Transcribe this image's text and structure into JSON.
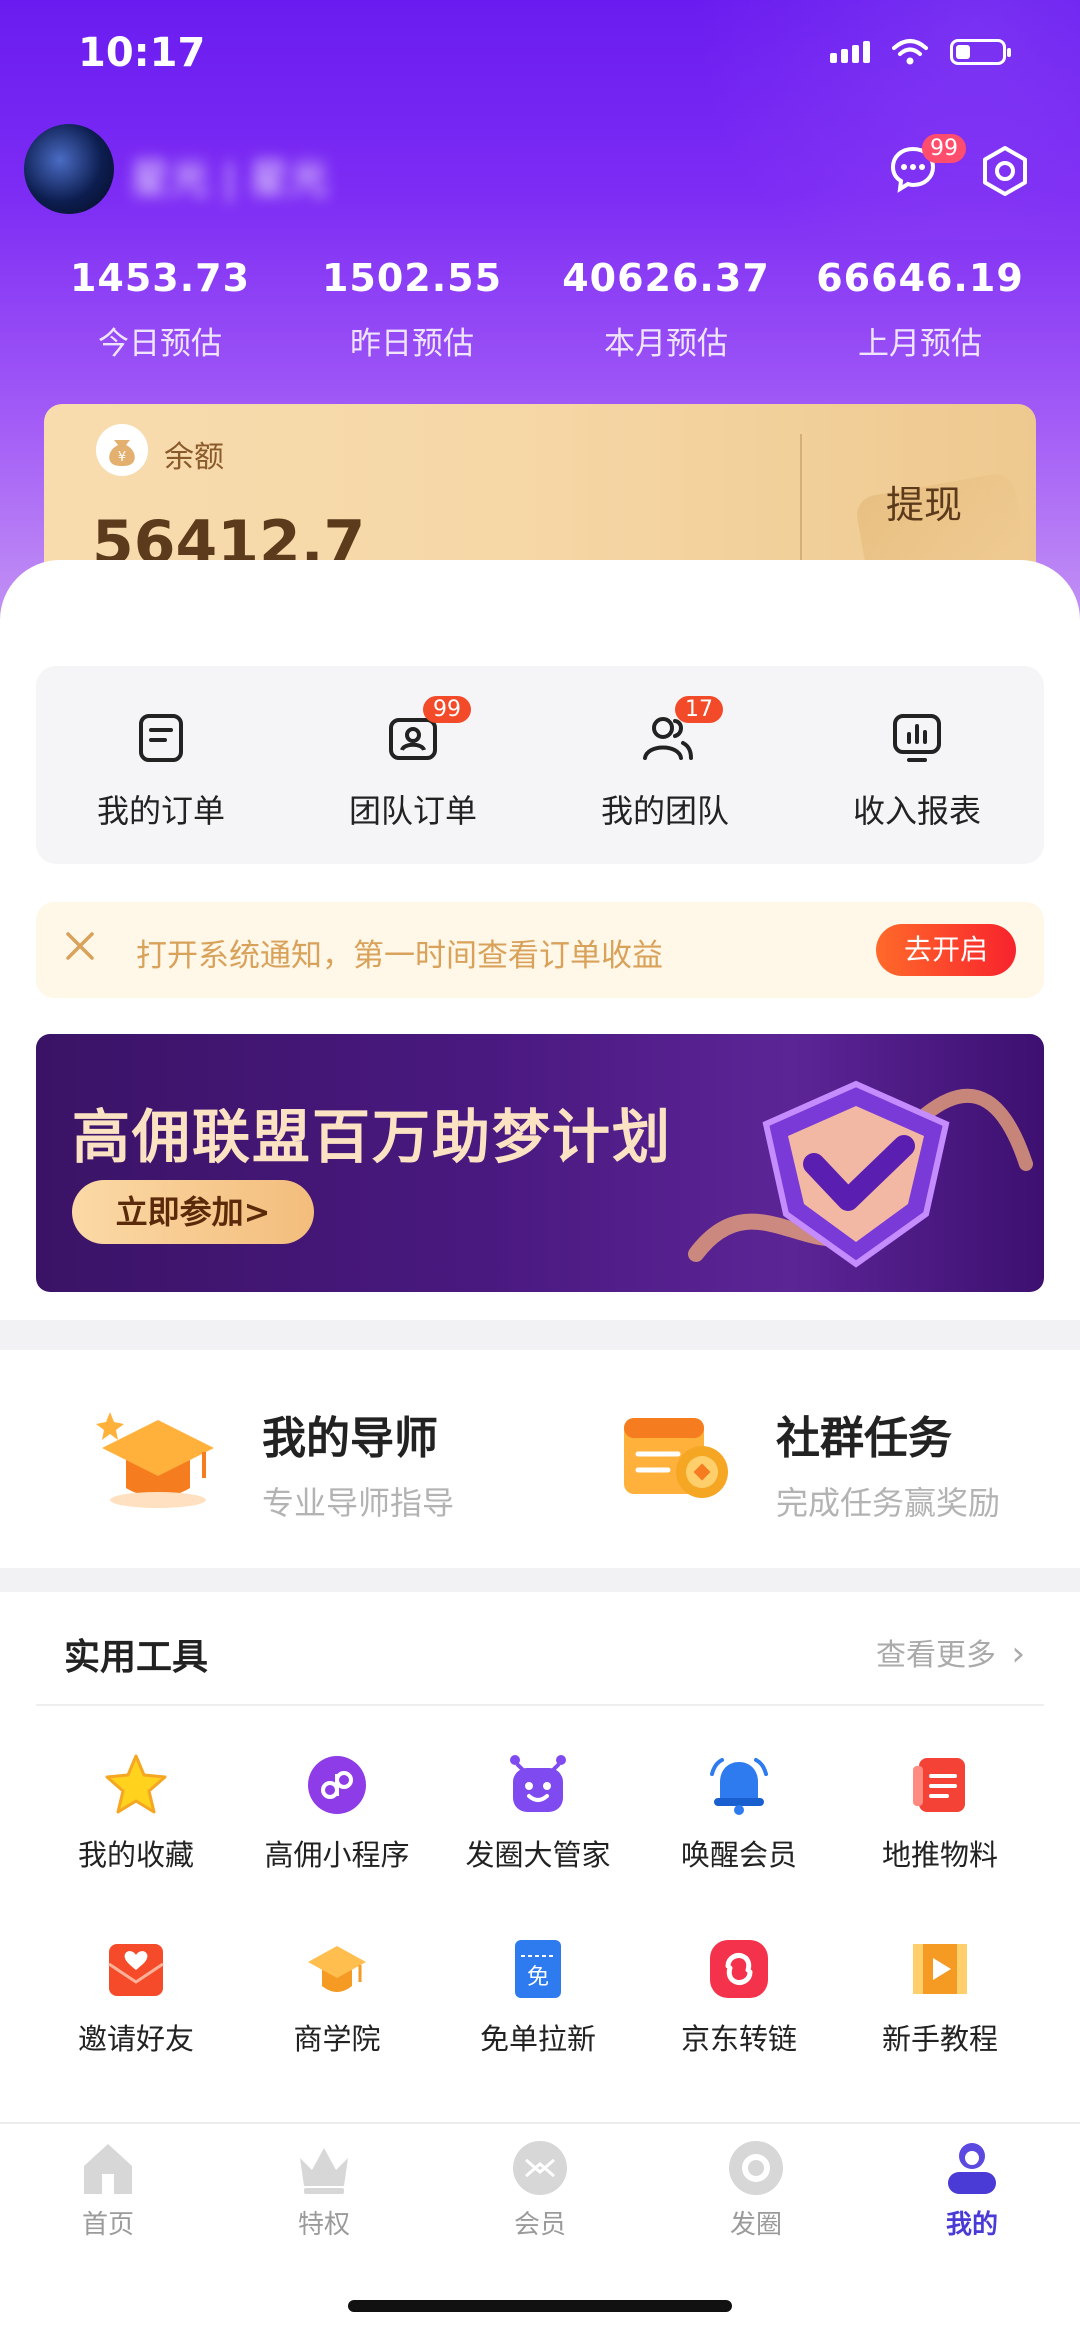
{
  "status_bar": {
    "time": "10:17"
  },
  "header": {
    "user_name": "星光 | 星光",
    "message_badge": "99"
  },
  "stats": [
    {
      "value": "1453.73",
      "label": "今日预估"
    },
    {
      "value": "1502.55",
      "label": "昨日预估"
    },
    {
      "value": "40626.37",
      "label": "本月预估"
    },
    {
      "value": "66646.19",
      "label": "上月预估"
    }
  ],
  "balance": {
    "label": "余额",
    "value": "56412.7",
    "withdraw": "提现"
  },
  "shortcuts": [
    {
      "label": "我的订单",
      "icon": "order-icon",
      "badge": ""
    },
    {
      "label": "团队订单",
      "icon": "team-order-icon",
      "badge": "99"
    },
    {
      "label": "我的团队",
      "icon": "team-icon",
      "badge": "17"
    },
    {
      "label": "收入报表",
      "icon": "report-icon",
      "badge": ""
    }
  ],
  "notice": {
    "text": "打开系统通知，第一时间查看订单收益",
    "button": "去开启"
  },
  "banner": {
    "title": "高佣联盟百万助梦计划",
    "button": "立即参加>"
  },
  "features": [
    {
      "title": "我的导师",
      "subtitle": "专业导师指导",
      "icon": "graduation-cap-icon"
    },
    {
      "title": "社群任务",
      "subtitle": "完成任务赢奖励",
      "icon": "task-calendar-icon"
    }
  ],
  "tools": {
    "title": "实用工具",
    "more": "查看更多",
    "items": [
      {
        "label": "我的收藏",
        "icon": "star-icon"
      },
      {
        "label": "高佣小程序",
        "icon": "mini-program-icon"
      },
      {
        "label": "发圈大管家",
        "icon": "robot-icon"
      },
      {
        "label": "唤醒会员",
        "icon": "bell-icon"
      },
      {
        "label": "地推物料",
        "icon": "document-icon"
      },
      {
        "label": "邀请好友",
        "icon": "invite-envelope-icon"
      },
      {
        "label": "商学院",
        "icon": "graduation-cap-icon"
      },
      {
        "label": "免单拉新",
        "icon": "free-ticket-icon"
      },
      {
        "label": "京东转链",
        "icon": "link-convert-icon"
      },
      {
        "label": "新手教程",
        "icon": "video-tutorial-icon"
      }
    ],
    "ticket_text": "免"
  },
  "tabbar": [
    {
      "label": "首页",
      "icon": "home-icon",
      "active": false
    },
    {
      "label": "特权",
      "icon": "crown-icon",
      "active": false
    },
    {
      "label": "会员",
      "icon": "member-icon",
      "active": false
    },
    {
      "label": "发圈",
      "icon": "circle-icon",
      "active": false
    },
    {
      "label": "我的",
      "icon": "profile-icon",
      "active": true
    }
  ],
  "colors": {
    "header_purple": "#6a1cf0",
    "accent_red": "#f34a2a",
    "active_tab": "#4a3ad6",
    "gold": "#f6d8a7"
  }
}
